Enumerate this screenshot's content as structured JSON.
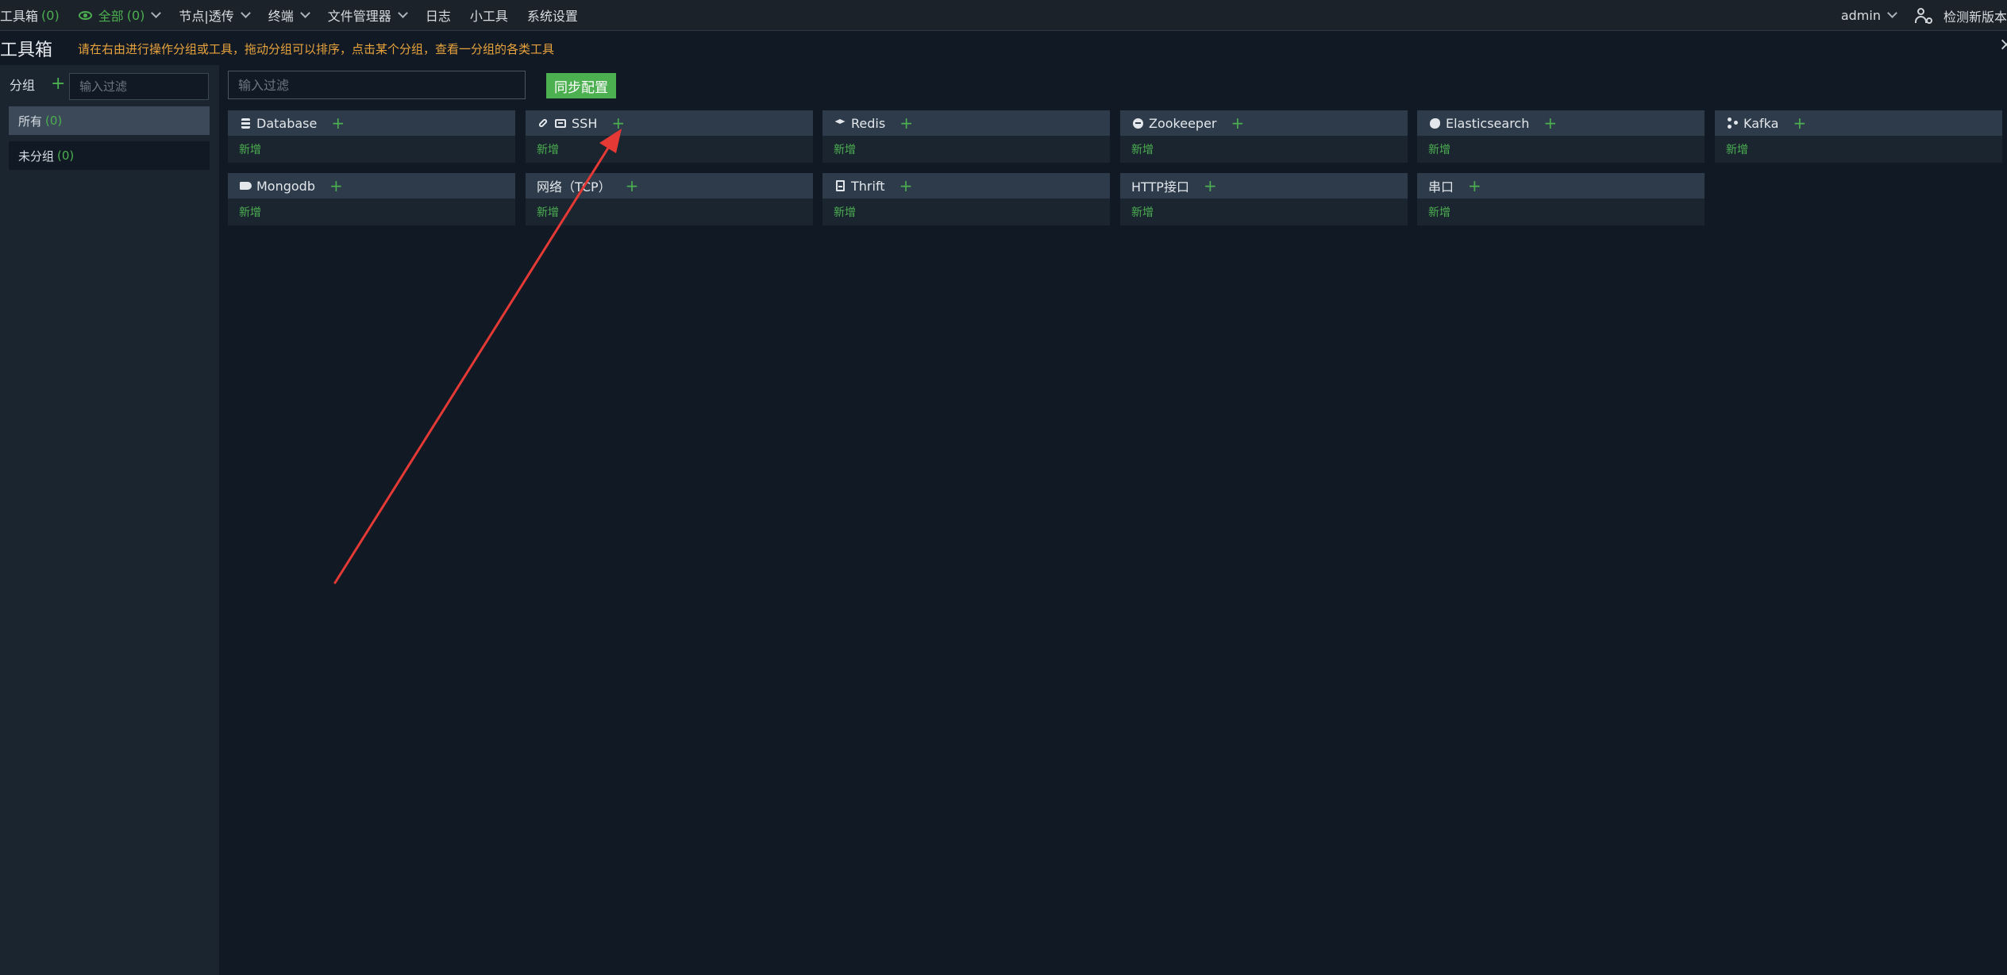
{
  "nav": {
    "toolbox_label": "工具箱",
    "toolbox_count": "(0)",
    "all_label": "全部",
    "all_count": "(0)",
    "node_label": "节点|透传",
    "terminal_label": "终端",
    "file_manager_label": "文件管理器",
    "log_label": "日志",
    "tools_label": "小工具",
    "settings_label": "系统设置",
    "user_label": "admin",
    "check_version_label": "检测新版本"
  },
  "page": {
    "title": "工具箱",
    "hint": "请在右由进行操作分组或工具，拖动分组可以排序，点击某个分组，查看一分组的各类工具",
    "close_symbol": "×"
  },
  "sidebar": {
    "header_label": "分组",
    "add_symbol": "+",
    "filter_placeholder": "输入过滤",
    "groups": [
      {
        "label": "所有",
        "count": "(0)"
      },
      {
        "label": "未分组",
        "count": "(0)"
      }
    ]
  },
  "main": {
    "filter_placeholder": "输入过滤",
    "sync_button": "同步配置",
    "add_symbol": "+",
    "add_link": "新增",
    "cards": [
      {
        "label": "Database",
        "icon": "database-icon"
      },
      {
        "label": "SSH",
        "icon": "terminal-icon"
      },
      {
        "label": "Redis",
        "icon": "redis-icon"
      },
      {
        "label": "Zookeeper",
        "icon": "zookeeper-icon"
      },
      {
        "label": "Elasticsearch",
        "icon": "elasticsearch-icon"
      },
      {
        "label": "Kafka",
        "icon": "kafka-icon"
      },
      {
        "label": "Mongodb",
        "icon": "mongodb-icon"
      },
      {
        "label": "网络（TCP）",
        "icon": ""
      },
      {
        "label": "Thrift",
        "icon": "file-icon"
      },
      {
        "label": "HTTP接口",
        "icon": ""
      },
      {
        "label": "串口",
        "icon": ""
      }
    ]
  },
  "colors": {
    "accent_green": "#4caf50",
    "hint_orange": "#e8a33d",
    "annotation_arrow": "#e53935",
    "background": "#111a24"
  }
}
